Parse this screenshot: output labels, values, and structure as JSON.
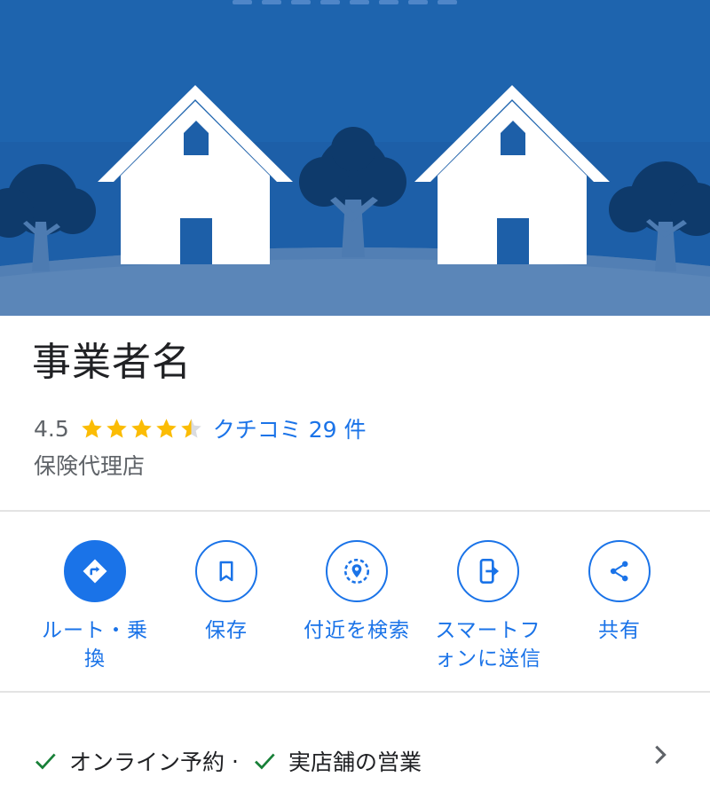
{
  "business": {
    "name": "事業者名",
    "rating": "4.5",
    "stars": 4.5,
    "reviews_label": "クチコミ 29 件",
    "category": "保険代理店"
  },
  "actions": [
    {
      "label": "ルート・乗\n換",
      "icon": "directions-icon",
      "filled": true
    },
    {
      "label": "保存",
      "icon": "bookmark-icon",
      "filled": false
    },
    {
      "label": "付近を検索",
      "icon": "nearby-search-icon",
      "filled": false
    },
    {
      "label": "スマートフ\nォンに送信",
      "icon": "send-to-phone-icon",
      "filled": false
    },
    {
      "label": "共有",
      "icon": "share-icon",
      "filled": false
    }
  ],
  "features": {
    "item1": "オンライン予約",
    "separator": "·",
    "item2": "実店舗の営業"
  },
  "colors": {
    "accent": "#1a73e8",
    "star": "#fbbc04",
    "check": "#188038",
    "hero_bg": "#1d5fa8"
  }
}
